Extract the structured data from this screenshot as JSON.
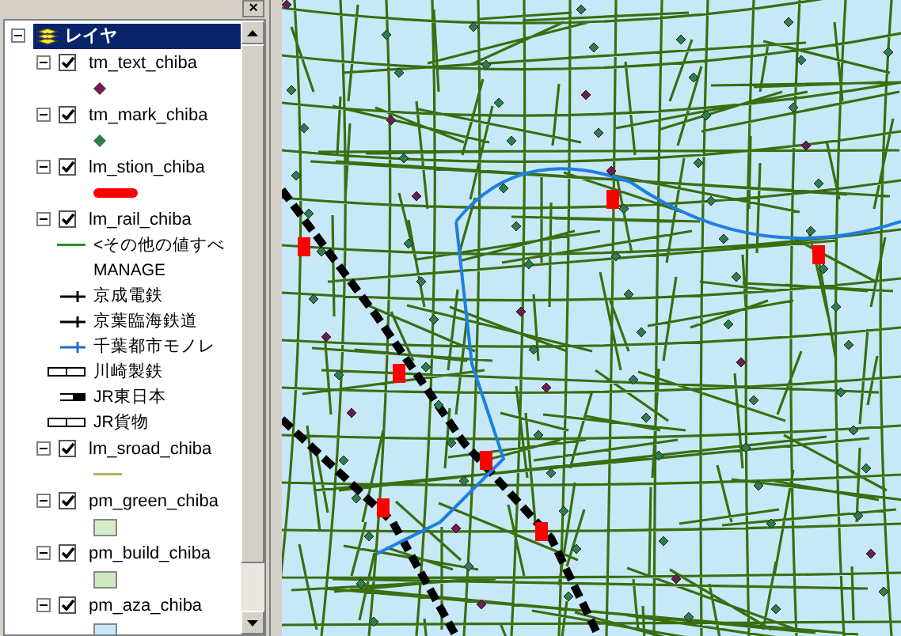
{
  "close_button": {
    "label": "×"
  },
  "toc": {
    "root": {
      "label": "レイヤ",
      "selected": true,
      "expanded": true
    },
    "layers": [
      {
        "name": "tm_text_chiba",
        "checked": true,
        "expanded": true,
        "legend": [
          {
            "kind": "point",
            "color": "#6b1e4f"
          }
        ]
      },
      {
        "name": "tm_mark_chiba",
        "checked": true,
        "expanded": true,
        "legend": [
          {
            "kind": "point",
            "color": "#2e7d4f"
          }
        ]
      },
      {
        "name": "lm_stion_chiba",
        "checked": true,
        "expanded": true,
        "legend": [
          {
            "kind": "thick",
            "color": "#ff0000"
          }
        ]
      },
      {
        "name": "lm_rail_chiba",
        "checked": true,
        "expanded": true,
        "legend": [
          {
            "kind": "line",
            "color": "#2e8b2e",
            "label": "<その他の値すべ"
          },
          {
            "kind": "none",
            "label": "MANAGE"
          },
          {
            "kind": "tick",
            "color": "#000000",
            "label": "京成電鉄"
          },
          {
            "kind": "tick",
            "color": "#000000",
            "label": "京葉臨海鉄道"
          },
          {
            "kind": "tick",
            "color": "#1e6fd0",
            "label": "千葉都市モノレ"
          },
          {
            "kind": "hollow",
            "color": "#000000",
            "label": "川崎製鉄"
          },
          {
            "kind": "dashed",
            "color": "#000000",
            "label": "JR東日本"
          },
          {
            "kind": "hollow",
            "color": "#000000",
            "label": "JR貨物"
          }
        ]
      },
      {
        "name": "lm_sroad_chiba",
        "checked": true,
        "expanded": true,
        "legend": [
          {
            "kind": "line",
            "color": "#b8b060"
          }
        ]
      },
      {
        "name": "pm_green_chiba",
        "checked": true,
        "expanded": true,
        "legend": [
          {
            "kind": "fill",
            "color": "#d4ecc8"
          }
        ]
      },
      {
        "name": "pm_build_chiba",
        "checked": true,
        "expanded": true,
        "legend": [
          {
            "kind": "fill",
            "color": "#d0e8c0"
          }
        ]
      },
      {
        "name": "pm_aza_chiba",
        "checked": true,
        "expanded": true,
        "legend": [
          {
            "kind": "fill",
            "color": "#c8e8f8"
          }
        ]
      }
    ]
  }
}
